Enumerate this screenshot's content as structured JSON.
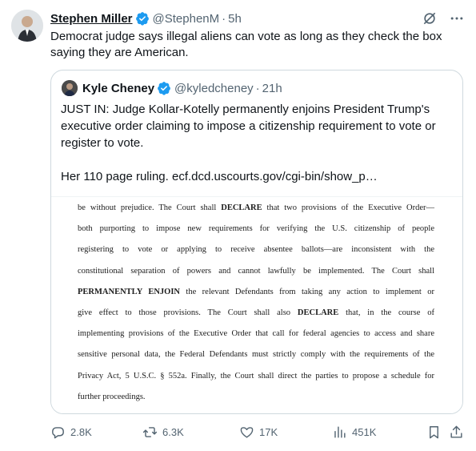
{
  "author": {
    "name": "Stephen Miller",
    "handle": "@StephenM",
    "time": "5h"
  },
  "tweet": {
    "text": "Democrat judge says illegal aliens can vote as long as they check the box saying they are American."
  },
  "quote": {
    "author": {
      "name": "Kyle Cheney",
      "handle": "@kyledcheney",
      "time": "21h"
    },
    "text": "JUST IN: Judge Kollar-Kotelly permanently enjoins President Trump's executive order claiming to impose a citizenship requirement to vote or register to vote.",
    "link_text": "Her 110 page ruling. ecf.dcd.uscourts.gov/cgi-bin/show_p…",
    "document_lines": [
      "be without prejudice.  The Court shall DECLARE that two provisions of the Executive Order—",
      "both purporting to impose new requirements for verifying the U.S. citizenship of people",
      "registering to vote or applying to receive absentee ballots—are inconsistent with the",
      "constitutional separation of powers and cannot lawfully be implemented.  The Court shall",
      "PERMANENTLY ENJOIN the relevant Defendants from taking any action to implement or",
      "give effect to those provisions.  The Court shall also DECLARE that, in the course of",
      "implementing provisions of the Executive Order that call for federal agencies to access and share",
      "sensitive personal data, the Federal Defendants must strictly comply with the requirements of the",
      "Privacy Act, 5 U.S.C. § 552a.  Finally, the Court shall direct the parties to propose a schedule for",
      "further proceedings."
    ]
  },
  "actions": {
    "replies": "2.8K",
    "reposts": "6.3K",
    "likes": "17K",
    "views": "451K"
  },
  "colors": {
    "verified": "#1d9bf0",
    "text": "#0f1419",
    "muted": "#536471",
    "border": "#cfd9de"
  }
}
